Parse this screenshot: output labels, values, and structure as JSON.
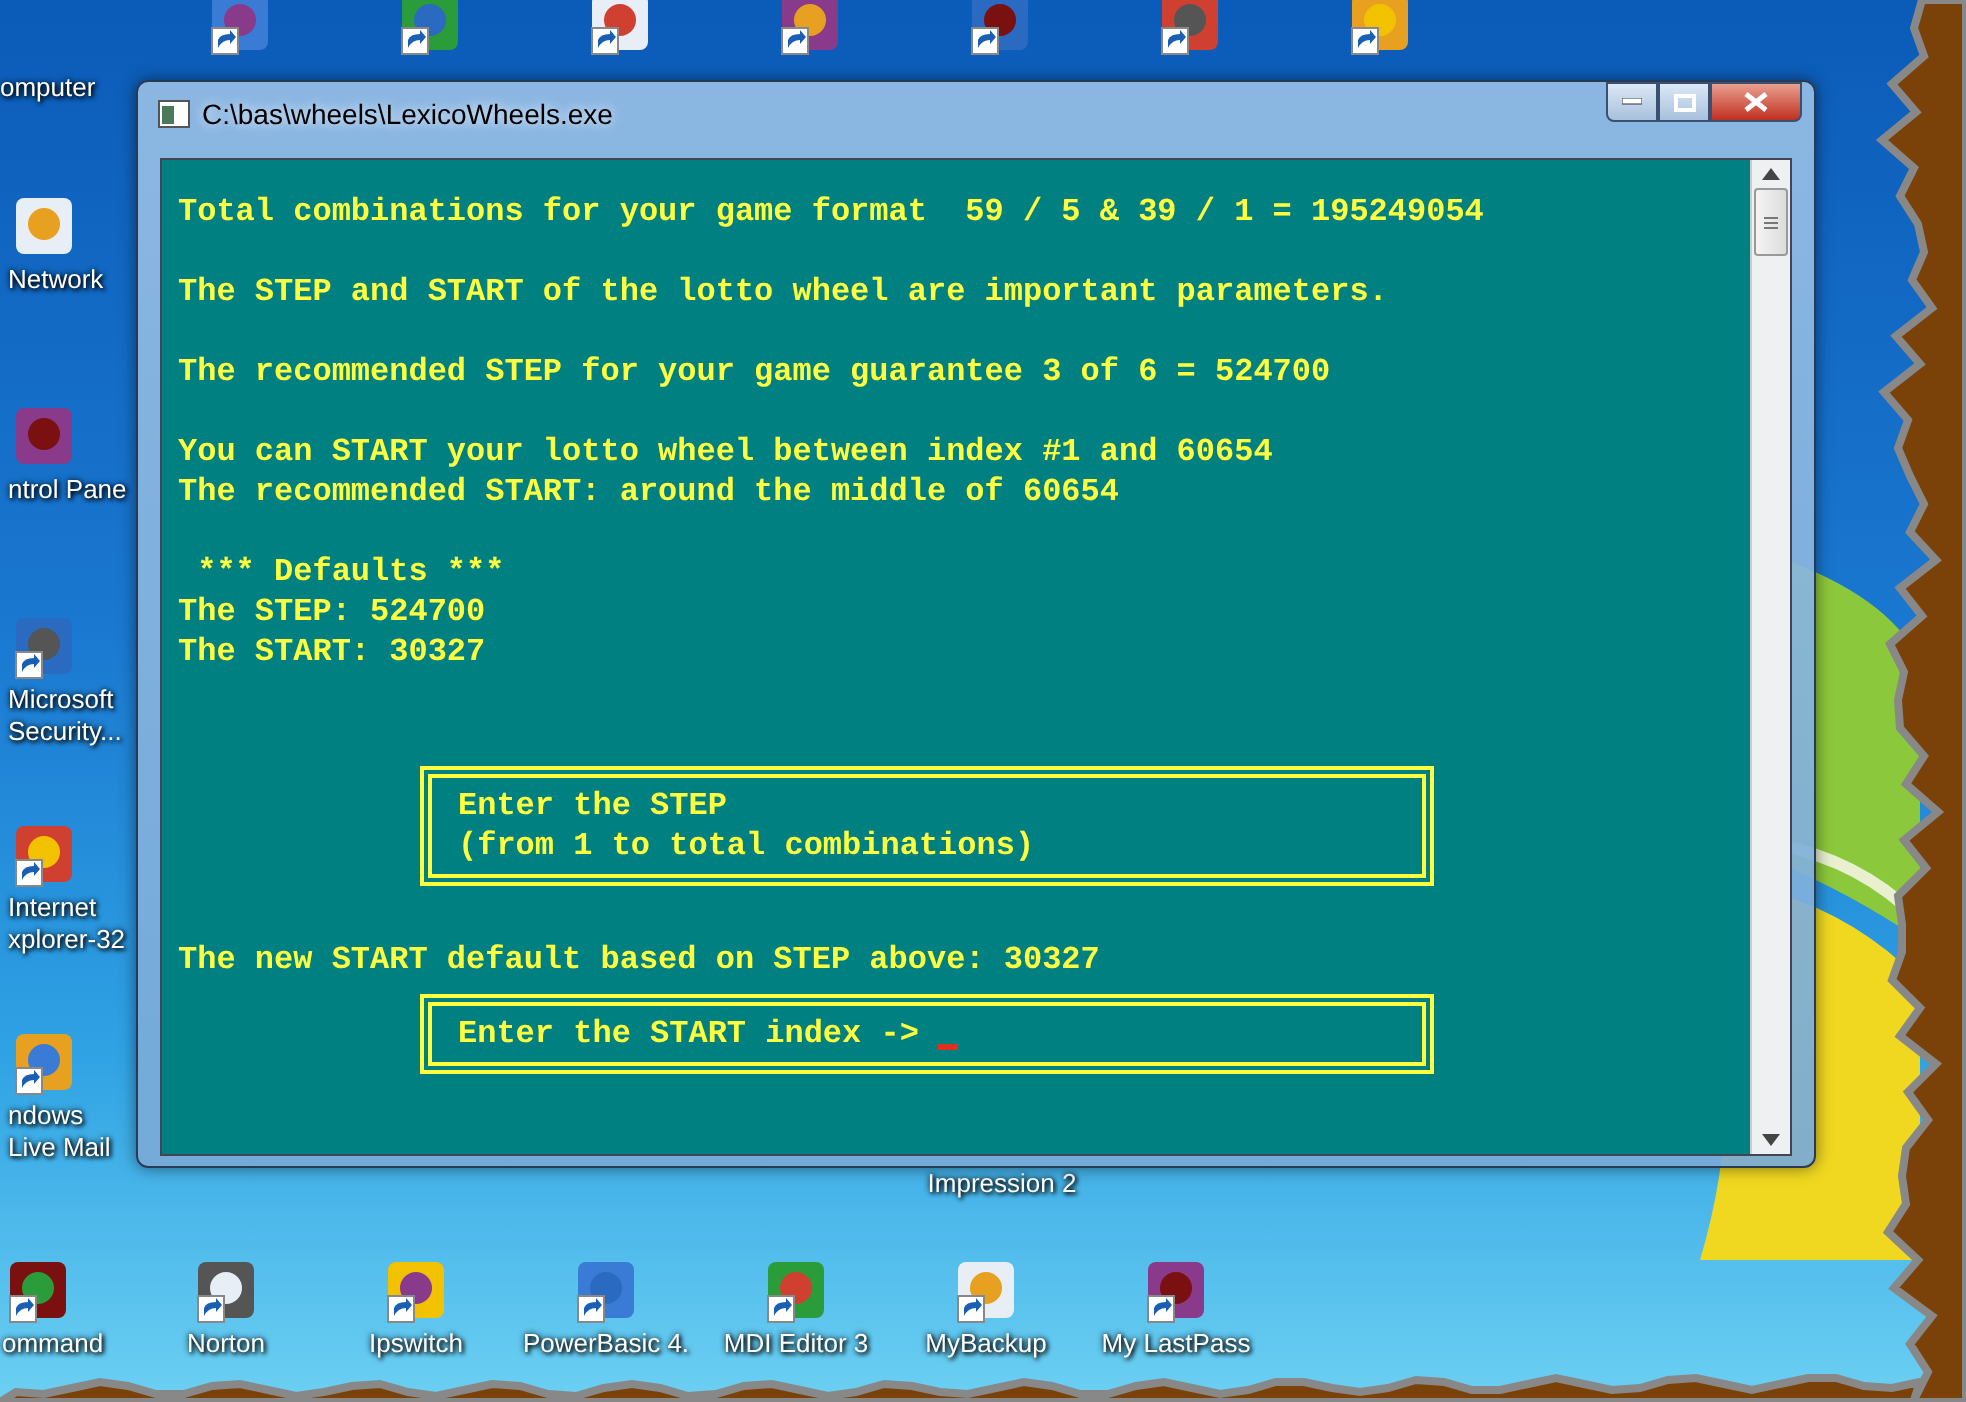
{
  "window": {
    "title": "C:\\bas\\wheels\\LexicoWheels.exe"
  },
  "console": [
    {
      "kind": "text",
      "text": "Total combinations for your game format  59 / 5 & 39 / 1 = 195249054"
    },
    {
      "kind": "blank"
    },
    {
      "kind": "text",
      "text": "The STEP and START of the lotto wheel are important parameters."
    },
    {
      "kind": "blank"
    },
    {
      "kind": "text",
      "text": "The recommended STEP for your game guarantee 3 of 6 = 524700"
    },
    {
      "kind": "blank"
    },
    {
      "kind": "text",
      "text": "You can START your lotto wheel between index #1 and 60654"
    },
    {
      "kind": "text",
      "text": "The recommended START: around the middle of 60654"
    },
    {
      "kind": "blank"
    },
    {
      "kind": "text",
      "text": " *** Defaults ***"
    },
    {
      "kind": "text",
      "text": "The STEP: 524700"
    },
    {
      "kind": "text",
      "text": "The START: 30327"
    },
    {
      "kind": "blank"
    },
    {
      "kind": "blank"
    },
    {
      "kind": "box",
      "lines": [
        "Enter the STEP",
        "(from 1 to total combinations)"
      ],
      "cursor": false
    },
    {
      "kind": "blank"
    },
    {
      "kind": "text",
      "text": "The new START default based on STEP above: 30327"
    },
    {
      "kind": "box",
      "lines": [
        "Enter the START index -> "
      ],
      "cursor": true
    }
  ],
  "left_icons": [
    {
      "label": "omputer"
    },
    {
      "label": "Network"
    },
    {
      "label": "ntrol Pane"
    },
    {
      "label": "Microsoft Security..."
    },
    {
      "label": "Internet xplorer-32"
    },
    {
      "label": "ndows Live Mail"
    }
  ],
  "hidden_icon_label": "Impression 2",
  "bottom_icons": [
    {
      "label": "ommand"
    },
    {
      "label": "Norton"
    },
    {
      "label": "Ipswitch"
    },
    {
      "label": "PowerBasic 4."
    },
    {
      "label": "MDI Editor 3"
    },
    {
      "label": "MyBackup"
    },
    {
      "label": "My LastPass"
    }
  ]
}
